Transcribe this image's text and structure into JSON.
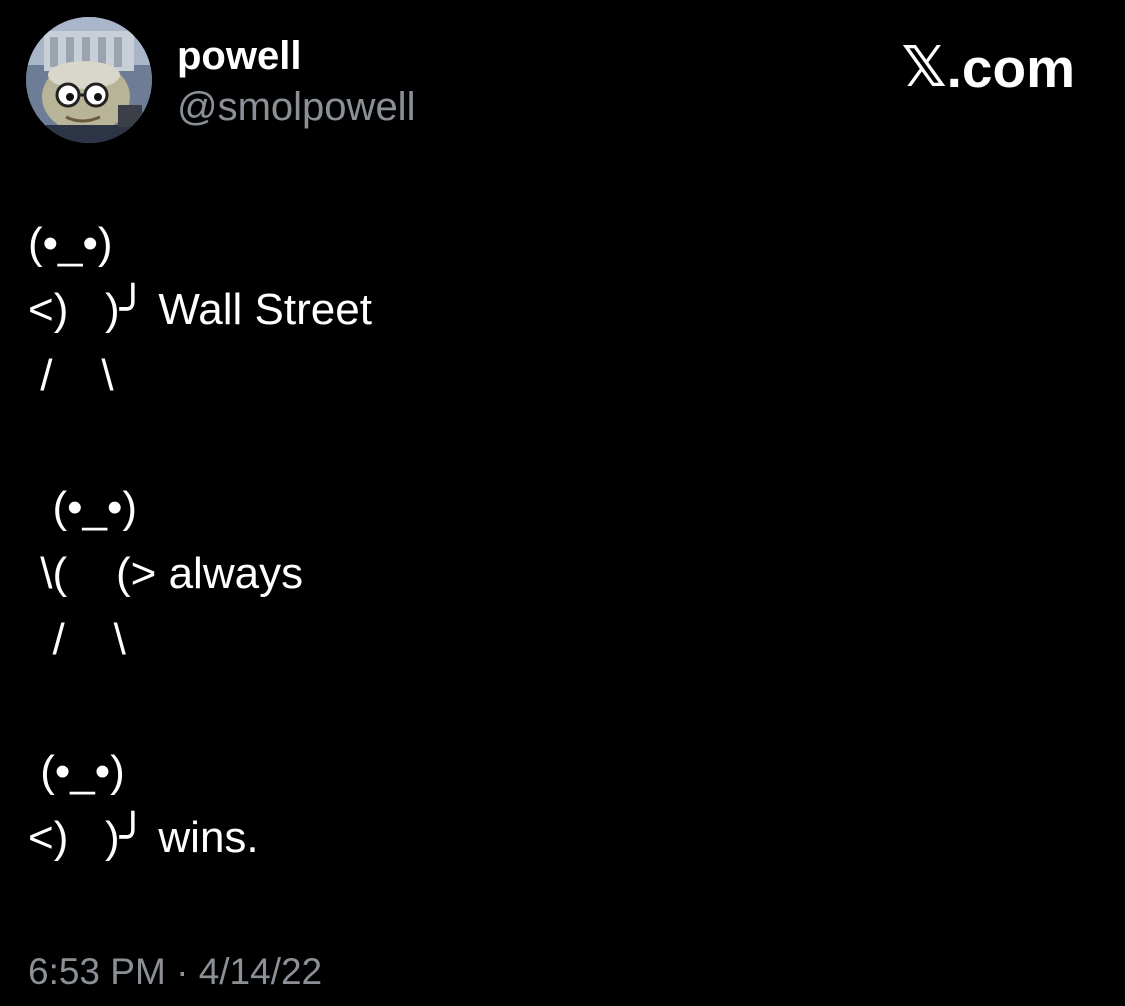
{
  "author": {
    "name": "powell",
    "handle": "@smolpowell"
  },
  "brand": {
    "logo": "x-logo",
    "domain": ".com"
  },
  "tweet": {
    "text": "(•_•)\n<)   )╯ Wall Street\n /    \\\n\n  (•_•)\n \\(    (> always\n  /    \\\n\n (•_•)\n<)   )╯ wins.",
    "time": "6:53 PM",
    "separator": "·",
    "date": "4/14/22"
  },
  "colors": {
    "background": "#000000",
    "primary_text": "#ffffff",
    "secondary_text": "#8b9097"
  }
}
